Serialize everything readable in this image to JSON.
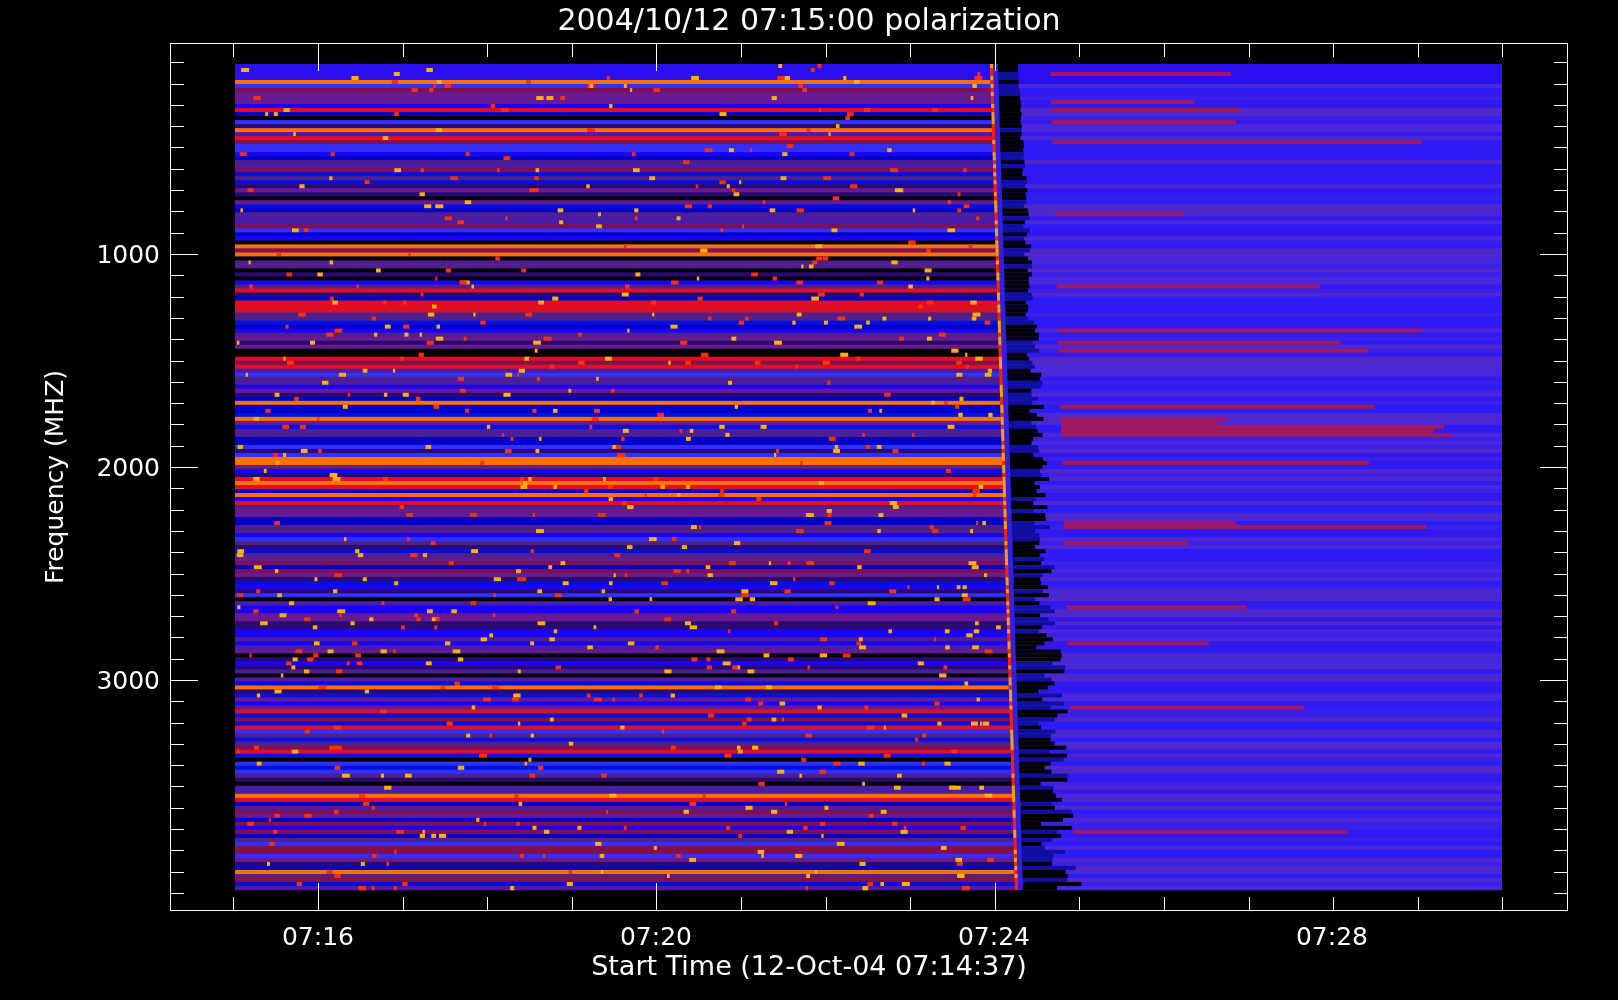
{
  "title": "2004/10/12 07:15:00 polarization",
  "plot": {
    "ylabel": "Frequency (MHZ)",
    "xlabel": "Start Time (12-Oct-04 07:14:37)",
    "yticks": [
      "1000",
      "2000",
      "3000"
    ],
    "xticks": [
      "07:16",
      "07:20",
      "07:24",
      "07:28"
    ]
  }
}
